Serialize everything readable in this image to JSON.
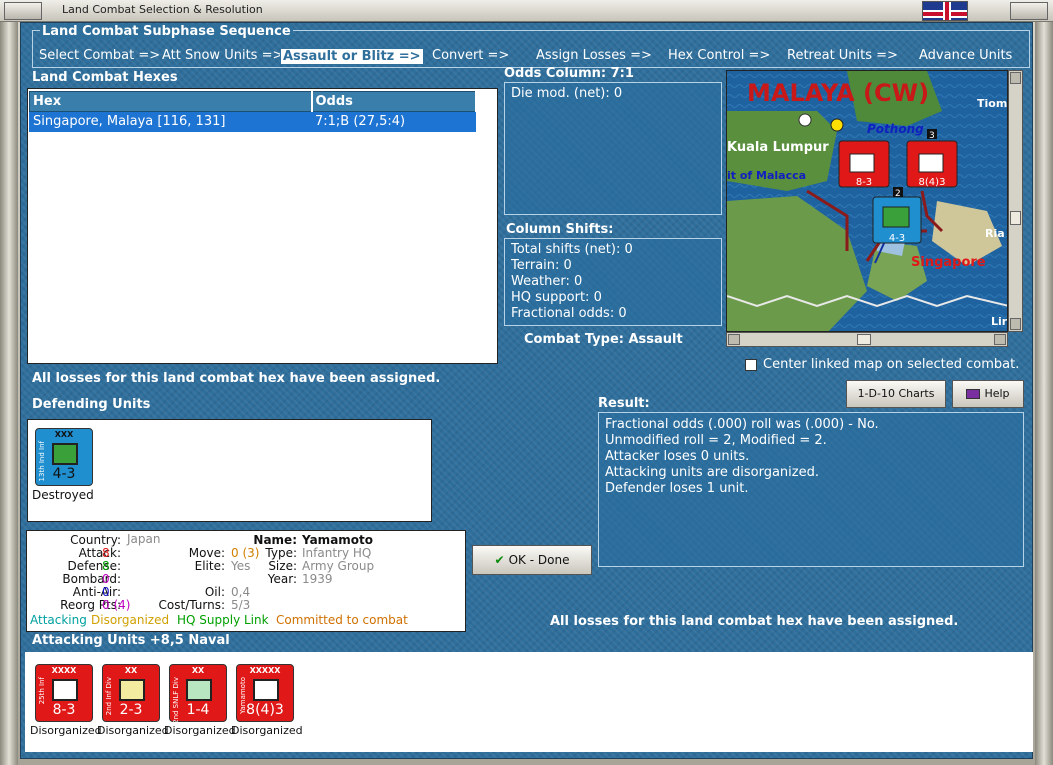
{
  "window": {
    "title": "Land Combat Selection & Resolution"
  },
  "sequence": {
    "title": "Land Combat Subphase Sequence",
    "items": [
      "Select Combat =>",
      "Att Snow Units =>",
      "Assault or Blitz =>",
      "Convert =>",
      "Assign Losses =>",
      "Hex Control =>",
      "Retreat Units =>",
      "Advance Units"
    ],
    "active_index": 2
  },
  "hexes": {
    "title": "Land Combat Hexes",
    "columns": [
      "Hex",
      "Odds"
    ],
    "rows": [
      {
        "hex": "Singapore, Malaya [116, 131]",
        "odds": "7:1;B (27,5:4)"
      }
    ]
  },
  "odds": {
    "title": "Odds Column: 7:1",
    "die_mod": "Die mod. (net): 0"
  },
  "shifts": {
    "title": "Column Shifts:",
    "lines": [
      "Total shifts (net): 0",
      "Terrain: 0",
      "Weather: 0",
      "HQ support: 0",
      "Fractional odds: 0"
    ]
  },
  "combat_type": "Combat Type:  Assault",
  "map": {
    "region": "MALAYA (CW)",
    "places": [
      "Kuala Lumpur",
      "Pothong",
      "it of Malacca",
      "Singapore",
      "Tiom",
      "Ria",
      "Lir"
    ],
    "stack_counts": [
      "3",
      "2"
    ]
  },
  "center_map_label": "Center linked map on selected combat.",
  "losses_msg": "All losses for this land combat hex have been assigned.",
  "buttons": {
    "charts": "1-D-10 Charts",
    "help": "Help",
    "ok": "OK - Done"
  },
  "defending": {
    "title": "Defending Units",
    "units": [
      {
        "name": "13th Ind Inf",
        "size": "XXX",
        "strength": "4-3",
        "status": "Destroyed",
        "color": "#1f8fd0",
        "symbol_color": "#3aa03a"
      }
    ]
  },
  "result": {
    "title": "Result:",
    "lines": [
      "Fractional odds (.000) roll was (.000)  - No.",
      "Unmodified roll = 2, Modified = 2.",
      "Attacker loses 0 units.",
      "Attacking units are disorganized.",
      "Defender loses 1 unit."
    ]
  },
  "info": {
    "country_label": "Country:",
    "country": "Japan",
    "attack_label": "Attack:",
    "attack": "8",
    "defense_label": "Defense:",
    "defense": "8",
    "bombard_label": "Bombard:",
    "bombard": "0",
    "antiair_label": "Anti-Air:",
    "antiair": "0",
    "reorg_label": "Reorg Pts:",
    "reorg": "0 (4)",
    "move_label": "Move:",
    "move": "0 (3)",
    "elite_label": "Elite:",
    "elite": "Yes",
    "oil_label": "Oil:",
    "oil": "0,4",
    "cost_label": "Cost/Turns:",
    "cost": "5/3",
    "name_label": "Name:",
    "name": "Yamamoto",
    "type_label": "Type:",
    "type": "Infantry HQ",
    "size_label": "Size:",
    "size": "Army Group",
    "year_label": "Year:",
    "year": "1939",
    "tags": [
      "Attacking",
      "Disorganized",
      "HQ Supply Link",
      "Committed to combat"
    ],
    "colors": {
      "red": "#e01818",
      "green": "#00a000",
      "purple": "#c000c0",
      "blue": "#1010d0",
      "gray": "#8a8a8a",
      "orange": "#d08000",
      "teal": "#00a0a0"
    }
  },
  "attacking": {
    "title": "Attacking Units +8,5 Naval",
    "units": [
      {
        "name": "25th Inf",
        "size": "XXXX",
        "strength": "8-3",
        "status": "Disorganized",
        "symbol_color": "#ffffff"
      },
      {
        "name": "2nd Inf Div",
        "size": "XX",
        "strength": "2-3",
        "status": "Disorganized",
        "symbol_color": "#f3eca0"
      },
      {
        "name": "2nd SNLF Div",
        "size": "XX",
        "strength": "1-4",
        "status": "Disorganized",
        "symbol_color": "#b8e6c0"
      },
      {
        "name": "Yamamoto",
        "size": "XXXXX",
        "strength": "8(4)3",
        "status": "Disorganized",
        "symbol_color": "#ffffff"
      }
    ]
  }
}
